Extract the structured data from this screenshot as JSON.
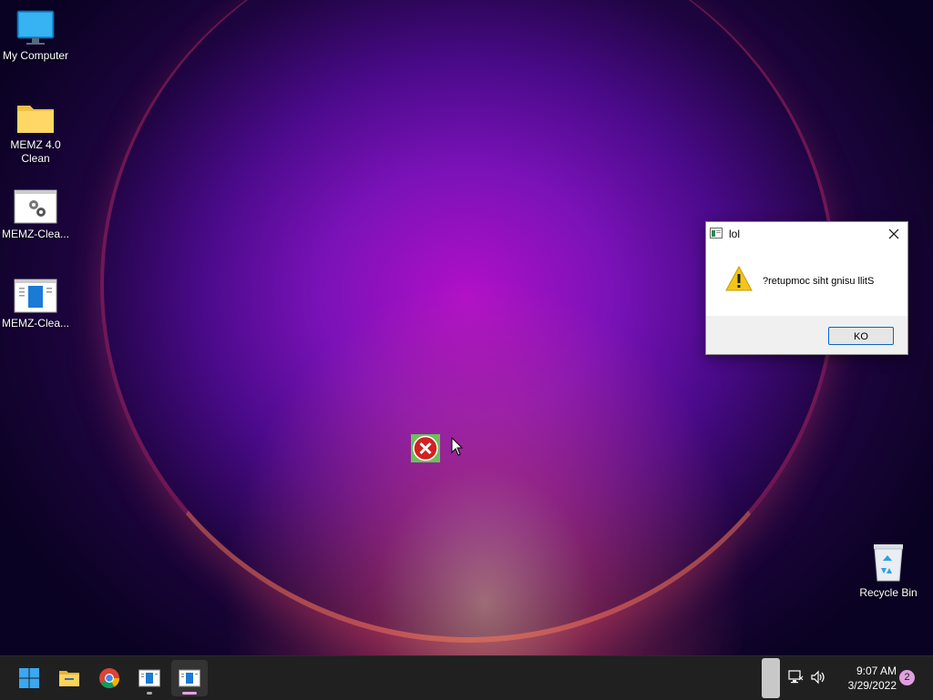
{
  "desktop": {
    "icons": [
      {
        "label": "My Computer",
        "icon": "monitor-icon"
      },
      {
        "label": "MEMZ 4.0\nClean",
        "icon": "folder-icon"
      },
      {
        "label": "MEMZ-Clea...",
        "icon": "settings-app-icon"
      },
      {
        "label": "MEMZ-Clea...",
        "icon": "window-app-icon"
      },
      {
        "label": "Recycle Bin",
        "icon": "recycle-bin-icon"
      }
    ]
  },
  "dialog": {
    "title": "lol",
    "message": "?retupmoc siht gnisu llitS",
    "ok_label": "KO",
    "icon": "warning-icon"
  },
  "taskbar": {
    "apps": [
      "start-icon",
      "file-explorer-icon",
      "chrome-icon",
      "memz-app-icon",
      "memz-app-icon"
    ],
    "time": "9:07 AM",
    "date": "3/29/2022",
    "notification_count": "2"
  },
  "colors": {
    "accent": "#0a64c8",
    "taskbar": "#202020",
    "notification_badge": "#e0a0e0"
  }
}
